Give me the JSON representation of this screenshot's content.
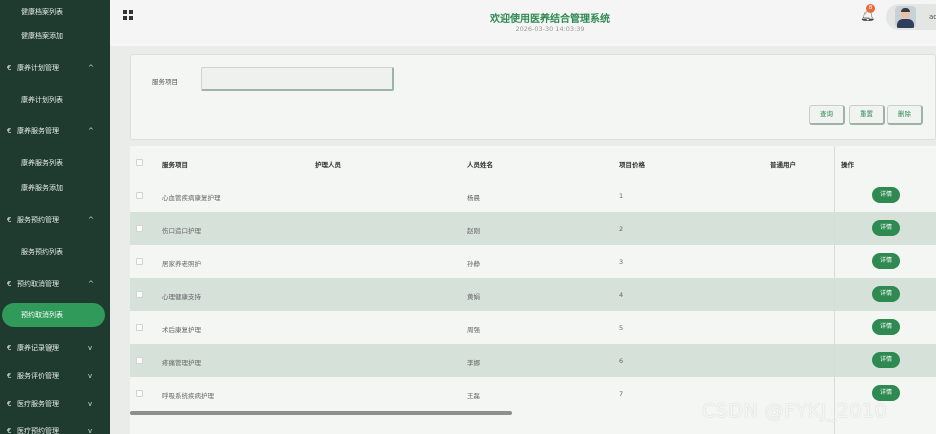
{
  "sidebar": {
    "items": [
      {
        "type": "sub",
        "label": "健康档案列表"
      },
      {
        "type": "sub",
        "label": "健康档案添加"
      },
      {
        "type": "group",
        "label": "康养计划管理",
        "chev": "^"
      },
      {
        "type": "sub",
        "label": "康养计划列表"
      },
      {
        "type": "group",
        "label": "康养服务管理",
        "chev": "^"
      },
      {
        "type": "sub",
        "label": "康养服务列表"
      },
      {
        "type": "sub",
        "label": "康养服务添加"
      },
      {
        "type": "group",
        "label": "服务预约管理",
        "chev": "^"
      },
      {
        "type": "sub",
        "label": "服务预约列表"
      },
      {
        "type": "group",
        "label": "预约取消管理",
        "chev": "^"
      },
      {
        "type": "active",
        "label": "预约取消列表"
      },
      {
        "type": "group",
        "label": "康养记录管理",
        "chev": "v"
      },
      {
        "type": "group",
        "label": "服务评价管理",
        "chev": "v"
      },
      {
        "type": "group",
        "label": "医疗服务管理",
        "chev": "v"
      },
      {
        "type": "group",
        "label": "医疗预约管理",
        "chev": "v"
      }
    ],
    "group_arrow": "€"
  },
  "header": {
    "title": "欢迎使用医养结合管理系统",
    "datetime": "2026-03-30 14:03:39",
    "notify_count": "8",
    "username": "admin"
  },
  "search": {
    "label": "服务项目",
    "value": "",
    "buttons": {
      "search": "查询",
      "reset": "重置",
      "delete": "删除"
    }
  },
  "table": {
    "headers": [
      "服务项目",
      "护理人员",
      "人员姓名",
      "项目价格",
      "普通用户",
      "操作"
    ],
    "rows": [
      {
        "service": "心血管疾病康复护理",
        "nurse": "",
        "name": "杨晨",
        "price": "1",
        "user": ""
      },
      {
        "service": "伤口造口护理",
        "nurse": "",
        "name": "赵刚",
        "price": "2",
        "user": ""
      },
      {
        "service": "居家养老照护",
        "nurse": "",
        "name": "孙静",
        "price": "3",
        "user": ""
      },
      {
        "service": "心理健康支持",
        "nurse": "",
        "name": "黄娟",
        "price": "4",
        "user": ""
      },
      {
        "service": "术后康复护理",
        "nurse": "",
        "name": "周强",
        "price": "5",
        "user": ""
      },
      {
        "service": "疼痛管理护理",
        "nurse": "",
        "name": "李娜",
        "price": "6",
        "user": ""
      },
      {
        "service": "呼吸系统疾病护理",
        "nurse": "",
        "name": "王磊",
        "price": "7",
        "user": ""
      }
    ],
    "detail_label": "详情"
  },
  "watermark": "CSDN @FYKJ_2010"
}
